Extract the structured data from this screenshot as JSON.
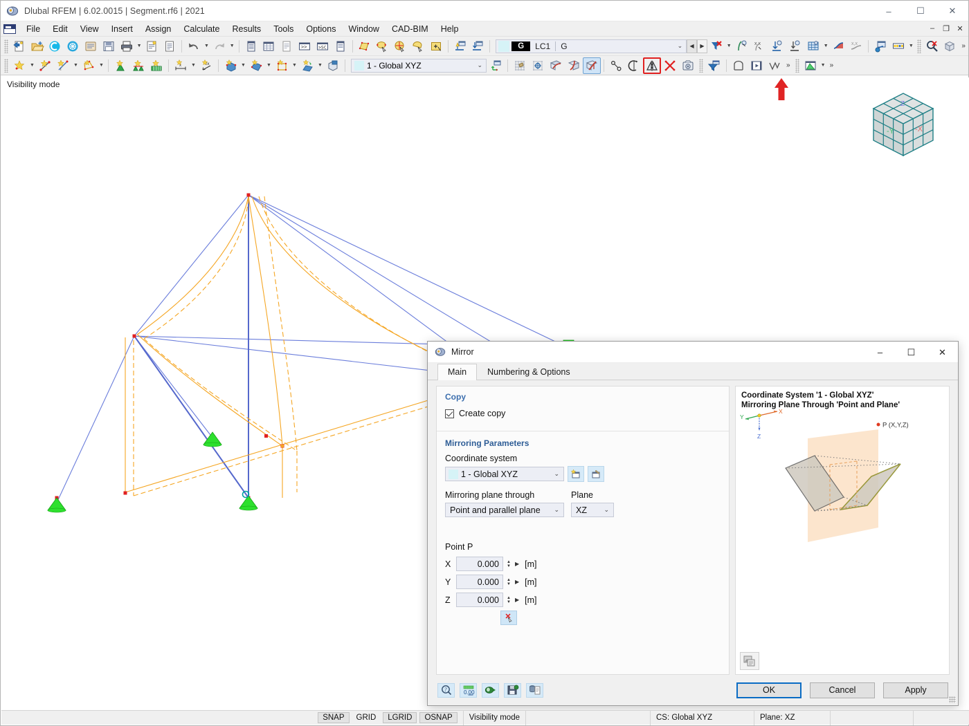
{
  "window": {
    "title": "Dlubal RFEM | 6.02.0015 | Segment.rf6 | 2021",
    "icon": "rfem-app-icon",
    "minimize": "–",
    "maximize": "☐",
    "close": "✕"
  },
  "mdi": {
    "minimize": "–",
    "restore": "❐",
    "close": "✕"
  },
  "menu": {
    "items": [
      {
        "label": "File"
      },
      {
        "label": "Edit"
      },
      {
        "label": "View"
      },
      {
        "label": "Insert"
      },
      {
        "label": "Assign"
      },
      {
        "label": "Calculate"
      },
      {
        "label": "Results"
      },
      {
        "label": "Tools"
      },
      {
        "label": "Options"
      },
      {
        "label": "Window"
      },
      {
        "label": "CAD-BIM"
      },
      {
        "label": "Help"
      }
    ]
  },
  "toolbar_main": {
    "load_case": {
      "color_swatch": "#d6f3f7",
      "badge": "G",
      "code": "LC1",
      "name": "G",
      "caret": "⌄",
      "prev": "◀",
      "next": "▶"
    }
  },
  "toolbar_second": {
    "coordinate_system": {
      "swatch": "#d6f3f7",
      "value": "1 - Global XYZ",
      "caret": "⌄"
    },
    "overflow": "»",
    "mirror_tool_tooltip": "Mirror"
  },
  "viewport": {
    "mode_label": "Visibility mode",
    "nav_cube": {
      "x_label": "-X",
      "y_label": "-Y",
      "z_label": "Z"
    }
  },
  "dialog": {
    "title": "Mirror",
    "icon": "mirror-dialog-icon",
    "minimize": "–",
    "maximize": "☐",
    "close": "✕",
    "tabs": [
      {
        "label": "Main",
        "active": true
      },
      {
        "label": "Numbering & Options",
        "active": false
      }
    ],
    "copy_group": {
      "heading": "Copy",
      "create_copy_label": "Create copy",
      "create_copy_checked": true
    },
    "mirroring_group": {
      "heading": "Mirroring Parameters",
      "coordinate_system_label": "Coordinate system",
      "coordinate_system_value": "1 - Global XYZ",
      "coordinate_system_swatch": "#d6f3f7",
      "new_cs_icon": "new-coordinate-system-icon",
      "edit_cs_icon": "edit-coordinate-system-icon",
      "plane_through_label": "Mirroring plane through",
      "plane_through_value": "Point and parallel plane",
      "plane_label": "Plane",
      "plane_value": "XZ"
    },
    "point_group": {
      "heading": "Point P",
      "rows": [
        {
          "axis": "X",
          "value": "0.000",
          "unit": "[m]"
        },
        {
          "axis": "Y",
          "value": "0.000",
          "unit": "[m]"
        },
        {
          "axis": "Z",
          "value": "0.000",
          "unit": "[m]"
        }
      ],
      "pick_icon": "pick-point-in-view-icon"
    },
    "preview": {
      "caption_line1": "Coordinate System '1 - Global XYZ'",
      "caption_line2": "Mirroring Plane Through 'Point and Plane'",
      "axis_x": "X",
      "axis_y": "Y",
      "axis_z": "Z",
      "point_label": "P (X,Y,Z)",
      "screenshot_icon": "copy-image-icon",
      "plane_color": "#fbe0c4",
      "source_color": "#5a5a5a",
      "mirrored_color": "#8a8a21"
    },
    "footer_tools": [
      {
        "icon": "help-icon"
      },
      {
        "icon": "decimal-places-icon"
      },
      {
        "icon": "units-icon"
      },
      {
        "icon": "save-settings-icon"
      },
      {
        "icon": "load-defaults-icon"
      }
    ],
    "buttons": {
      "ok": "OK",
      "cancel": "Cancel",
      "apply": "Apply"
    }
  },
  "statusbar": {
    "toggles": [
      {
        "label": "SNAP",
        "on": true
      },
      {
        "label": "GRID",
        "on": false
      },
      {
        "label": "LGRID",
        "on": true
      },
      {
        "label": "OSNAP",
        "on": true
      }
    ],
    "mode": "Visibility mode",
    "cs": "CS: Global XYZ",
    "plane": "Plane: XZ"
  }
}
